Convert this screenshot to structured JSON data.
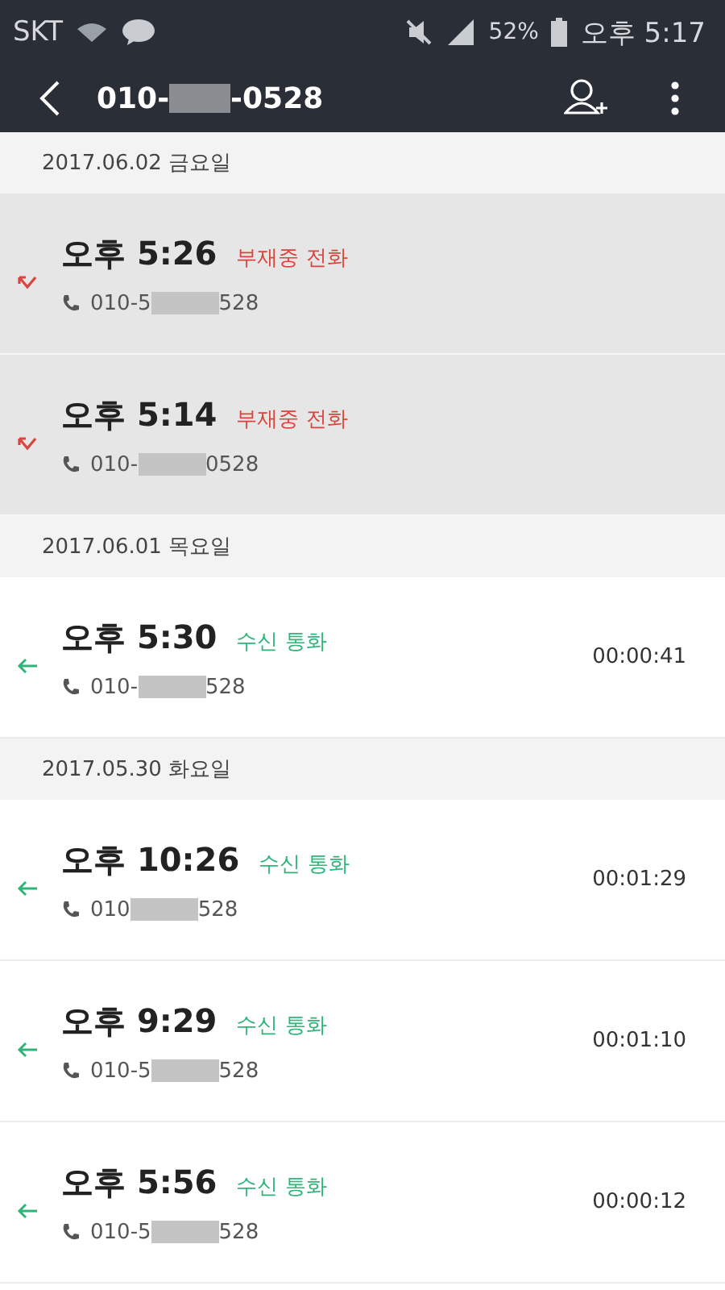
{
  "status_bar": {
    "carrier": "SKT",
    "battery_percent": "52%",
    "time": "오후 5:17"
  },
  "header": {
    "number_start": "010-",
    "number_end": "-0528"
  },
  "sections": [
    {
      "date": "2017.06.02 금요일",
      "calls": [
        {
          "kind": "missed",
          "time": "오후 5:26",
          "label": "부재중 전화",
          "number_start": "010-5",
          "number_end": "528"
        },
        {
          "kind": "missed",
          "time": "오후 5:14",
          "label": "부재중 전화",
          "number_start": "010-",
          "number_end": "0528"
        }
      ]
    },
    {
      "date": "2017.06.01 목요일",
      "calls": [
        {
          "kind": "received",
          "time": "오후 5:30",
          "label": "수신 통화",
          "number_start": "010-",
          "number_end": "528",
          "duration": "00:00:41"
        }
      ]
    },
    {
      "date": "2017.05.30 화요일",
      "calls": [
        {
          "kind": "received",
          "time": "오후 10:26",
          "label": "수신 통화",
          "number_start": "010",
          "number_end": "528",
          "duration": "00:01:29"
        },
        {
          "kind": "received",
          "time": "오후 9:29",
          "label": "수신 통화",
          "number_start": "010-5",
          "number_end": "528",
          "duration": "00:01:10"
        },
        {
          "kind": "received",
          "time": "오후 5:56",
          "label": "수신 통화",
          "number_start": "010-5",
          "number_end": "528",
          "duration": "00:00:12"
        }
      ]
    }
  ]
}
